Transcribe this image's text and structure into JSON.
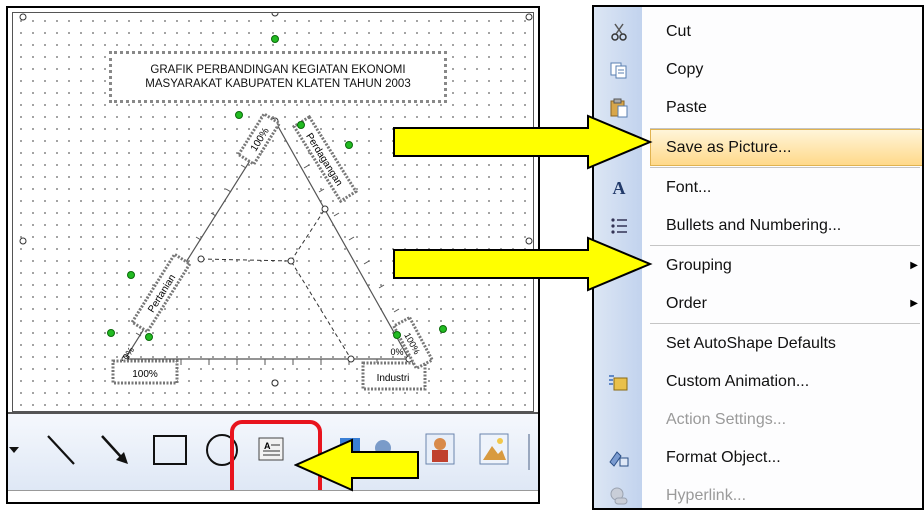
{
  "chart": {
    "title_line1": "GRAFIK PERBANDINGAN KEGIATAN EKONOMI",
    "title_line2": "MASYARAKAT KABUPATEN KLATEN TAHUN 2003",
    "label_left_side": "Pertanian",
    "label_right_side": "Perdagangan",
    "label_bottom": "Industri",
    "label_top_pct": "100%",
    "label_bottom_left_pct": "100%",
    "label_bottom_right_pct": "100%",
    "label_zero_left": "0%",
    "label_zero_right": "0%"
  },
  "toolbar": {
    "tools": [
      "more-arrow-icon",
      "line-icon",
      "arrow-icon",
      "rectangle-icon",
      "oval-icon",
      "text-box-icon",
      "wordart-icon",
      "diagram-icon",
      "clipart-icon",
      "picture-icon"
    ],
    "highlight_color": "#e8141e"
  },
  "context_menu": {
    "items": [
      {
        "label": "Cut",
        "icon": "scissors-icon",
        "enabled": true
      },
      {
        "label": "Copy",
        "icon": "copy-icon",
        "enabled": true
      },
      {
        "label": "Paste",
        "icon": "paste-icon",
        "enabled": true
      },
      {
        "label": "Save as Picture...",
        "icon": "",
        "enabled": true,
        "highlighted": true
      },
      {
        "label": "Font...",
        "icon": "font-icon",
        "enabled": true
      },
      {
        "label": "Bullets and Numbering...",
        "icon": "bullets-icon",
        "enabled": true
      },
      {
        "label": "Grouping",
        "icon": "",
        "enabled": true,
        "submenu": true
      },
      {
        "label": "Order",
        "icon": "",
        "enabled": true,
        "submenu": true
      },
      {
        "label": "Set AutoShape Defaults",
        "icon": "",
        "enabled": true
      },
      {
        "label": "Custom Animation...",
        "icon": "animation-icon",
        "enabled": true
      },
      {
        "label": "Action Settings...",
        "icon": "",
        "enabled": false
      },
      {
        "label": "Format Object...",
        "icon": "format-object-icon",
        "enabled": true
      },
      {
        "label": "Hyperlink...",
        "icon": "hyperlink-icon",
        "enabled": false
      }
    ],
    "highlight_color": "#ffd98a",
    "icon_strip_color": "#c2d3ee"
  },
  "annotations": {
    "arrow_fill": "#ffff00",
    "arrow_stroke": "#000000",
    "arrows": [
      "arrow-to-save-as-picture",
      "arrow-to-grouping",
      "arrow-to-text-box"
    ]
  }
}
